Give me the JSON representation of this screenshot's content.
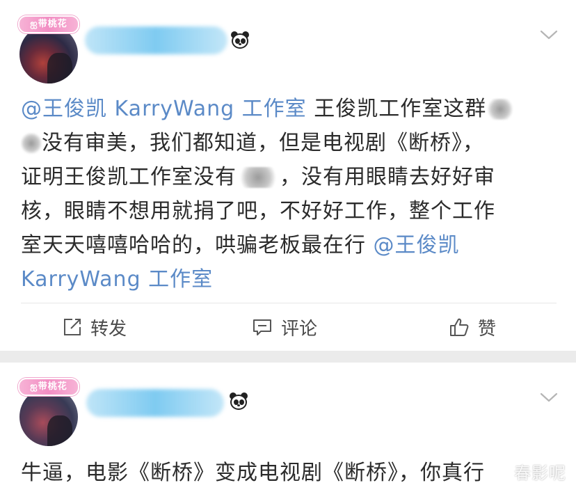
{
  "posts": [
    {
      "badge": "ஐ带桃花",
      "text_before": "王俊凯工作室这群",
      "mention": "@王俊凯 KarryWang 工作室",
      "line_a": "没有审美，我们都知道，但是电视剧《断桥》，",
      "line_b_pre": "证明王俊凯工作室没有",
      "line_b_post": "，没有用眼睛去好好审",
      "line_c": "核，眼睛不想用就捐了吧，不好好工作，整个工作",
      "line_d": "室天天嘻嘻哈哈的，哄骗老板最在行",
      "mention_end_a": "@王俊凯",
      "mention_end_b": "KarryWang 工作室",
      "actions": {
        "repost": "转发",
        "comment": "评论",
        "like": "赞"
      }
    },
    {
      "badge": "ஐ带桃花",
      "text": "牛逼，电影《断桥》变成电视剧《断桥》，你真行"
    }
  ],
  "icons": {
    "chevron": "chevron-down-icon",
    "repost": "repost-icon",
    "comment": "comment-icon",
    "like": "thumbs-up-icon",
    "vip": "panda-icon"
  },
  "colors": {
    "mention": "#5b8ac7",
    "background": "#ebebeb",
    "card": "#ffffff",
    "text": "#2b2b2b"
  },
  "watermark": "春影呢"
}
